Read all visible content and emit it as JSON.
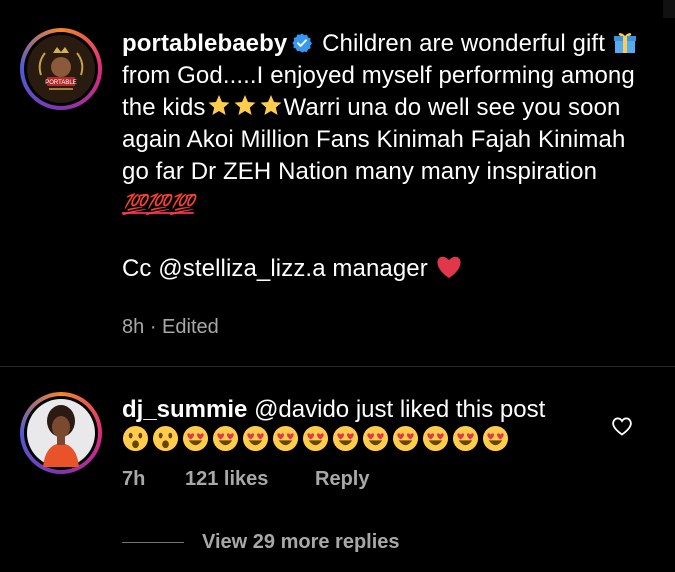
{
  "post": {
    "username": "portablebaeby",
    "caption_part1": "Children are wonderful gift",
    "caption_part2": "from God.....I enjoyed myself performing among the kids",
    "caption_part3": "Warri una do well see you soon again Akoi Million Fans Kinimah Fajah Kinimah go far Dr ZEH Nation many many inspiration",
    "hundreds": "💯💯💯",
    "cc_text": "Cc @stelliza_lizz.a manager",
    "time": "8h",
    "separator": "·",
    "edited": "Edited",
    "avatar_logo_text": "PORTABLE"
  },
  "comment": {
    "username": "dj_summie",
    "text": "@davido just liked this post",
    "time": "7h",
    "likes": "121 likes",
    "reply": "Reply",
    "emojis": [
      "astonished",
      "astonished",
      "heart-eyes",
      "heart-eyes",
      "heart-eyes",
      "heart-eyes",
      "heart-eyes",
      "heart-eyes",
      "heart-eyes",
      "heart-eyes",
      "heart-eyes",
      "heart-eyes",
      "heart-eyes"
    ]
  },
  "replies": {
    "label": "View 29 more replies"
  },
  "colors": {
    "muted": "#a8a8a8",
    "verified": "#3897f0",
    "heart": "#ed4956"
  }
}
